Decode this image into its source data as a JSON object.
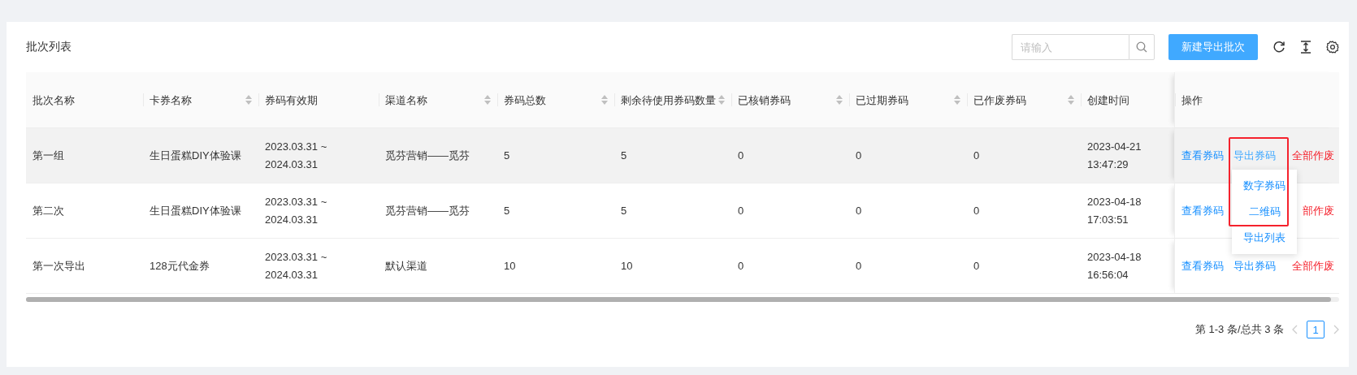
{
  "card": {
    "title": "批次列表"
  },
  "toolbar": {
    "search": {
      "placeholder": "请输入"
    },
    "primary_button": "新建导出批次"
  },
  "table": {
    "columns": [
      {
        "label": "批次名称",
        "sortable": false
      },
      {
        "label": "卡券名称",
        "sortable": true
      },
      {
        "label": "券码有效期",
        "sortable": false
      },
      {
        "label": "渠道名称",
        "sortable": true
      },
      {
        "label": "券码总数",
        "sortable": true
      },
      {
        "label": "剩余待使用券码数量",
        "sortable": true
      },
      {
        "label": "已核销券码",
        "sortable": true
      },
      {
        "label": "已过期券码",
        "sortable": true
      },
      {
        "label": "已作废券码",
        "sortable": true
      },
      {
        "label": "创建时间",
        "sortable": false
      },
      {
        "label": "操作",
        "sortable": false
      }
    ],
    "rows": [
      {
        "highlighted": true,
        "cells": [
          "第一组",
          "生日蛋糕DIY体验课",
          "2023.03.31 ~ 2024.03.31",
          "觅芬营销——觅芬",
          "5",
          "5",
          "0",
          "0",
          "0",
          "2023-04-21 13:47:29"
        ],
        "actions": [
          {
            "kind": "view",
            "text": "查看券码"
          },
          {
            "kind": "export",
            "text": "导出券码",
            "expanded": true,
            "menu": [
              "数字券码",
              "二维码",
              "导出列表"
            ]
          },
          {
            "kind": "void",
            "text": "全部作废"
          }
        ]
      },
      {
        "highlighted": false,
        "cells": [
          "第二次",
          "生日蛋糕DIY体验课",
          "2023.03.31 ~ 2024.03.31",
          "觅芬营销——觅芬",
          "5",
          "5",
          "0",
          "0",
          "0",
          "2023-04-18 17:03:51"
        ],
        "actions": [
          {
            "kind": "view",
            "text": "查看券码"
          },
          {
            "kind": "void",
            "text": "部作废"
          }
        ]
      },
      {
        "highlighted": false,
        "cells": [
          "第一次导出",
          "128元代金券",
          "2023.03.31 ~ 2024.03.31",
          "默认渠道",
          "10",
          "10",
          "0",
          "0",
          "0",
          "2023-04-18 16:56:04"
        ],
        "actions": [
          {
            "kind": "view",
            "text": "查看券码"
          },
          {
            "kind": "export",
            "text": "导出券码",
            "expanded": false
          },
          {
            "kind": "void",
            "text": "全部作废"
          }
        ]
      }
    ]
  },
  "pagination": {
    "summary": "第 1-3 条/总共 3 条",
    "pages": [
      {
        "label": "1",
        "selected": true
      }
    ]
  }
}
